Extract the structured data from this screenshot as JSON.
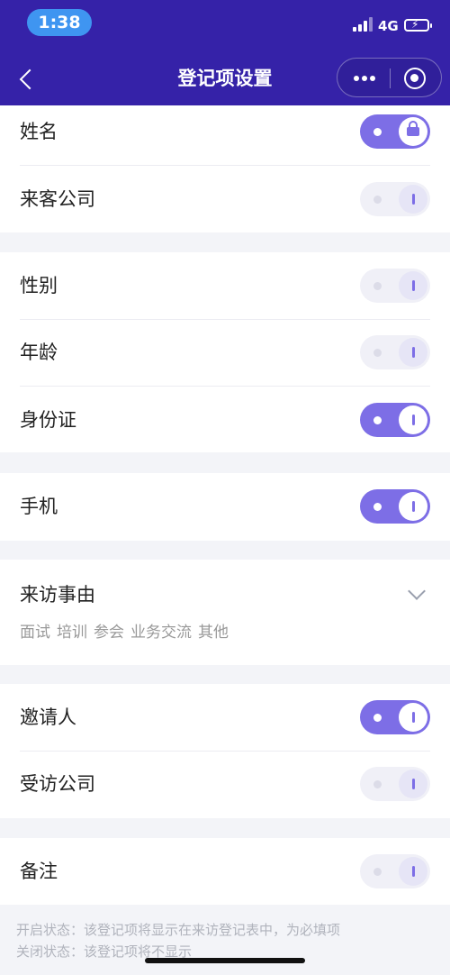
{
  "status_bar": {
    "time": "1:38",
    "network": "4G"
  },
  "nav": {
    "title": "登记项设置"
  },
  "sections": [
    {
      "rows": [
        {
          "label": "姓名",
          "state": "on",
          "locked": true
        },
        {
          "label": "来客公司",
          "state": "off",
          "locked": false
        }
      ]
    },
    {
      "rows": [
        {
          "label": "性别",
          "state": "off",
          "locked": false
        },
        {
          "label": "年龄",
          "state": "off",
          "locked": false
        },
        {
          "label": "身份证",
          "state": "on",
          "locked": false
        }
      ]
    },
    {
      "rows": [
        {
          "label": "手机",
          "state": "on",
          "locked": false
        }
      ]
    },
    {
      "reason": {
        "label": "来访事由",
        "options": [
          "面试",
          "培训",
          "参会",
          "业务交流",
          "其他"
        ]
      }
    },
    {
      "rows": [
        {
          "label": "邀请人",
          "state": "on",
          "locked": false
        },
        {
          "label": "受访公司",
          "state": "off",
          "locked": false
        }
      ]
    },
    {
      "rows": [
        {
          "label": "备注",
          "state": "off",
          "locked": false
        }
      ]
    }
  ],
  "notes": {
    "on_state": "开启状态：该登记项将显示在来访登记表中，为必填项",
    "off_state": "关闭状态：该登记项将不显示"
  },
  "colors": {
    "header": "#3522a8",
    "accent": "#7d6ee6",
    "time_pill": "#3f95f1"
  }
}
